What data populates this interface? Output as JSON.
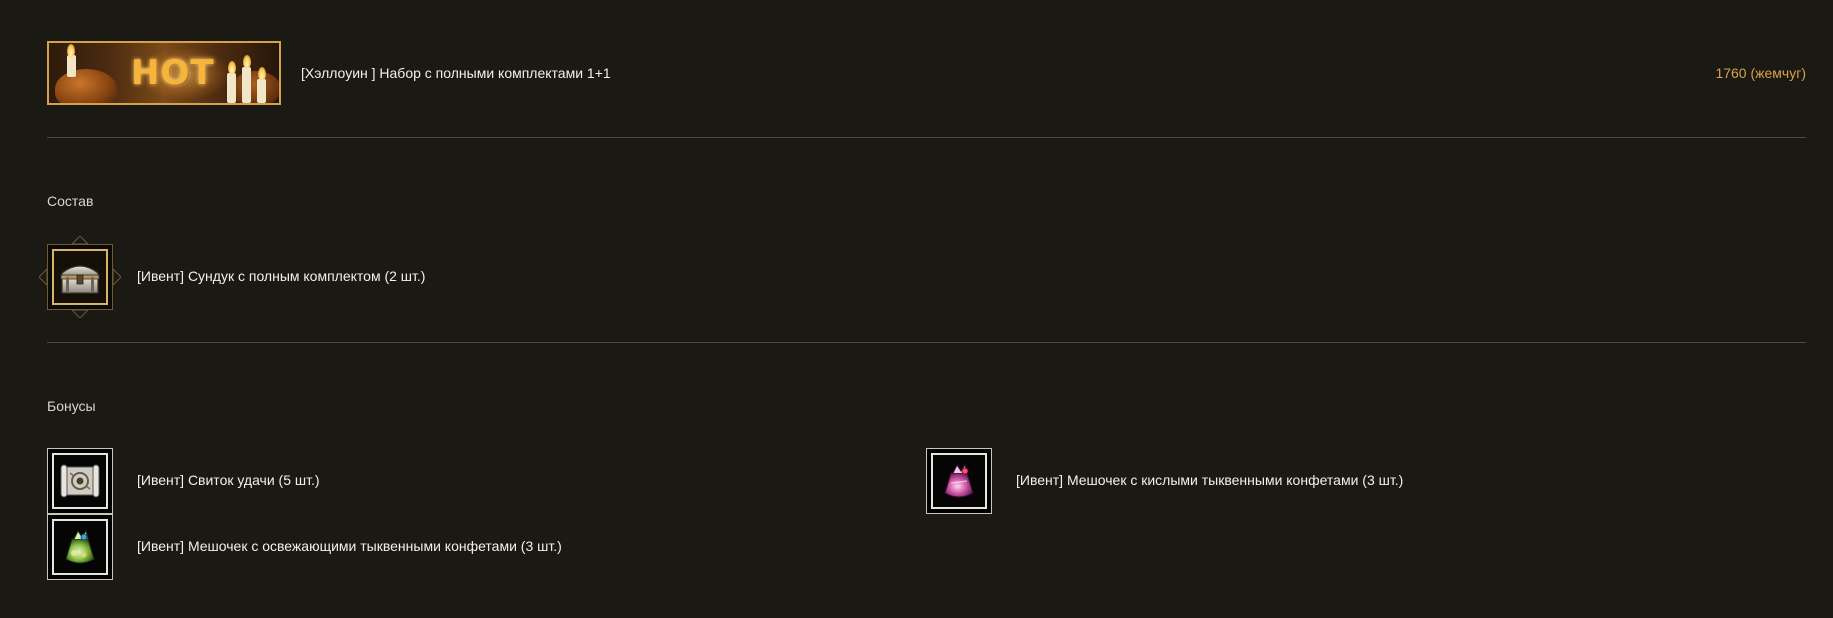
{
  "header": {
    "banner_text": "HOT",
    "title": "[Хэллоуин ] Набор с полными комплектами 1+1",
    "price": "1760 (жемчуг)"
  },
  "composition": {
    "label": "Состав",
    "items": [
      {
        "label": "[Ивент] Сундук с полным комплектом (2 шт.)",
        "icon": "chest-icon"
      }
    ]
  },
  "bonuses": {
    "label": "Бонусы",
    "items": [
      {
        "label": "[Ивент] Свиток удачи (5 шт.)",
        "icon": "scroll-icon"
      },
      {
        "label": "[Ивент] Мешочек с кислыми тыквенными конфетами (3 шт.)",
        "icon": "pink-candy-bag-icon"
      },
      {
        "label": "[Ивент] Мешочек с освежающими тыквенными конфетами (3 шт.)",
        "icon": "green-candy-bag-icon"
      }
    ]
  },
  "colors": {
    "background": "#1a1913",
    "price": "#d7a24c",
    "banner_border": "#d4a24a",
    "divider": "#4b4a3c"
  }
}
